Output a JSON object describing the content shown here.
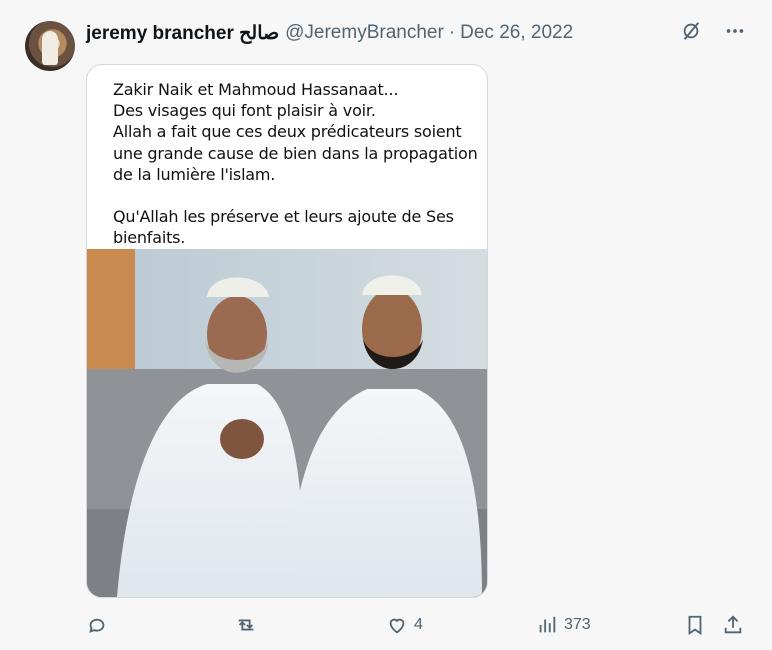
{
  "author": {
    "display_name": "jeremy brancher صالح",
    "handle": "@JeremyBrancher",
    "separator": "·",
    "date": "Dec 26, 2022"
  },
  "top_icons": [
    "grok-icon",
    "more-icon"
  ],
  "card": {
    "lines": [
      "Zakir Naik et Mahmoud Hassanaat...",
      "Des visages qui font plaisir à voir.",
      "Allah a fait que ces deux prédicateurs soient une grande cause de bien dans la propagation de la lumière l'islam."
    ],
    "closing": "Qu'Allah les préserve et leurs ajoute de Ses bienfaits."
  },
  "actions": {
    "reply_count": "",
    "retweet_count": "",
    "like_count": "4",
    "views_count": "373"
  },
  "colors": {
    "text": "#0f1419",
    "muted": "#536471",
    "border": "#cfd9de"
  }
}
